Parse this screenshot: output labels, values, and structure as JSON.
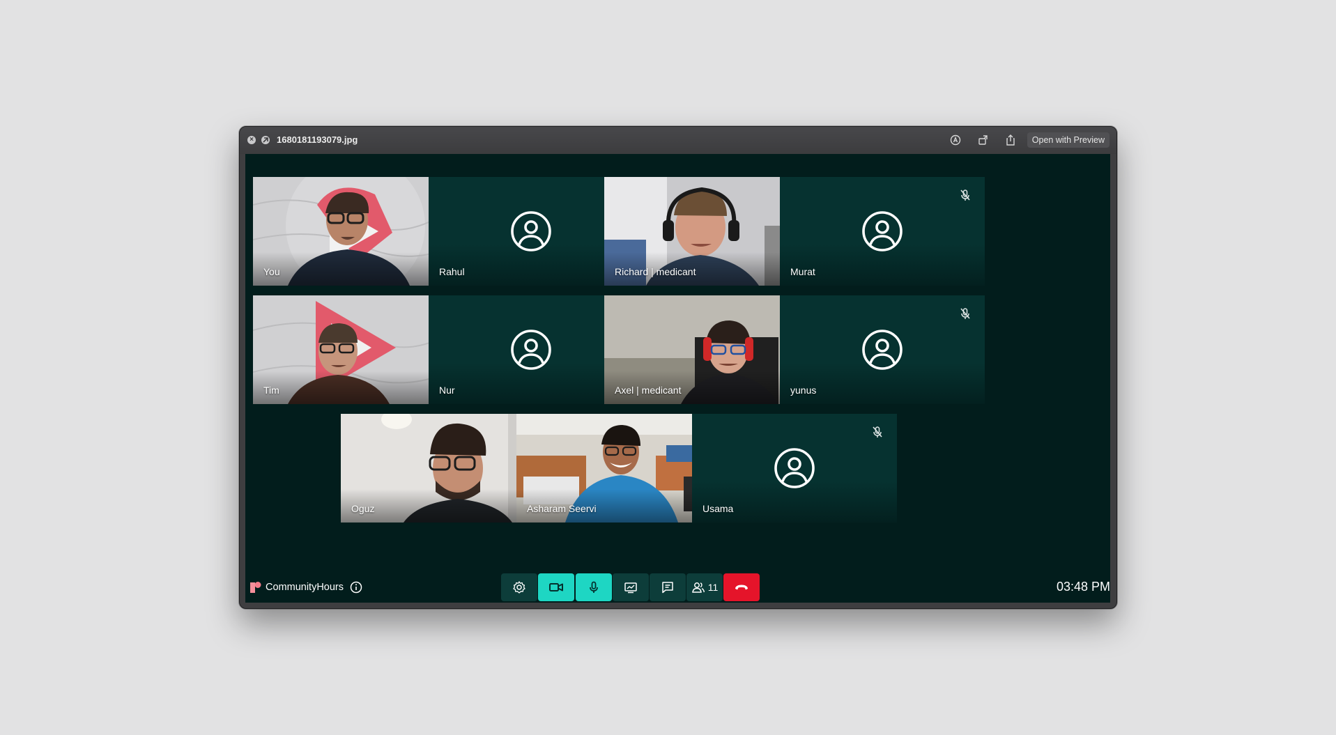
{
  "window": {
    "file_name": "1680181193079.jpg",
    "open_with_label": "Open with Preview",
    "close_icon": "close-icon",
    "fullscreen_icon": "fullscreen-icon",
    "markup_icon": "markup-icon",
    "rotate_icon": "rotate-icon",
    "share_icon": "share-icon"
  },
  "participants": [
    {
      "name": "You",
      "video": true,
      "muted": false,
      "active": true
    },
    {
      "name": "Rahul",
      "video": false,
      "muted": true
    },
    {
      "name": "Richard | medicant",
      "video": true,
      "muted": true
    },
    {
      "name": "Murat",
      "video": false,
      "muted": true
    },
    {
      "name": "Tim",
      "video": true,
      "muted": false
    },
    {
      "name": "Nur",
      "video": false,
      "muted": true
    },
    {
      "name": "Axel | medicant",
      "video": true,
      "muted": false
    },
    {
      "name": "yunus",
      "video": false,
      "muted": true
    },
    {
      "name": "Oguz",
      "video": true,
      "muted": false
    },
    {
      "name": "Asharam Seervi",
      "video": true,
      "muted": false
    },
    {
      "name": "Usama",
      "video": false,
      "muted": true
    }
  ],
  "toolbar": {
    "brand": "CommunityHours",
    "info_icon": "info-icon",
    "settings_icon": "gear-icon",
    "camera_icon": "video-camera-icon",
    "mic_icon": "microphone-icon",
    "screenshare_icon": "screen-share-icon",
    "chat_icon": "chat-icon",
    "participants_icon": "participants-icon",
    "participants_count": "11",
    "hangup_icon": "hang-up-icon",
    "time": "03:48 PM"
  },
  "colors": {
    "meeting_bg": "#021d1c",
    "tile_bg": "#063230",
    "accent": "#1ed6c3",
    "end_call": "#e5142a",
    "brand": "#f47c8a"
  }
}
